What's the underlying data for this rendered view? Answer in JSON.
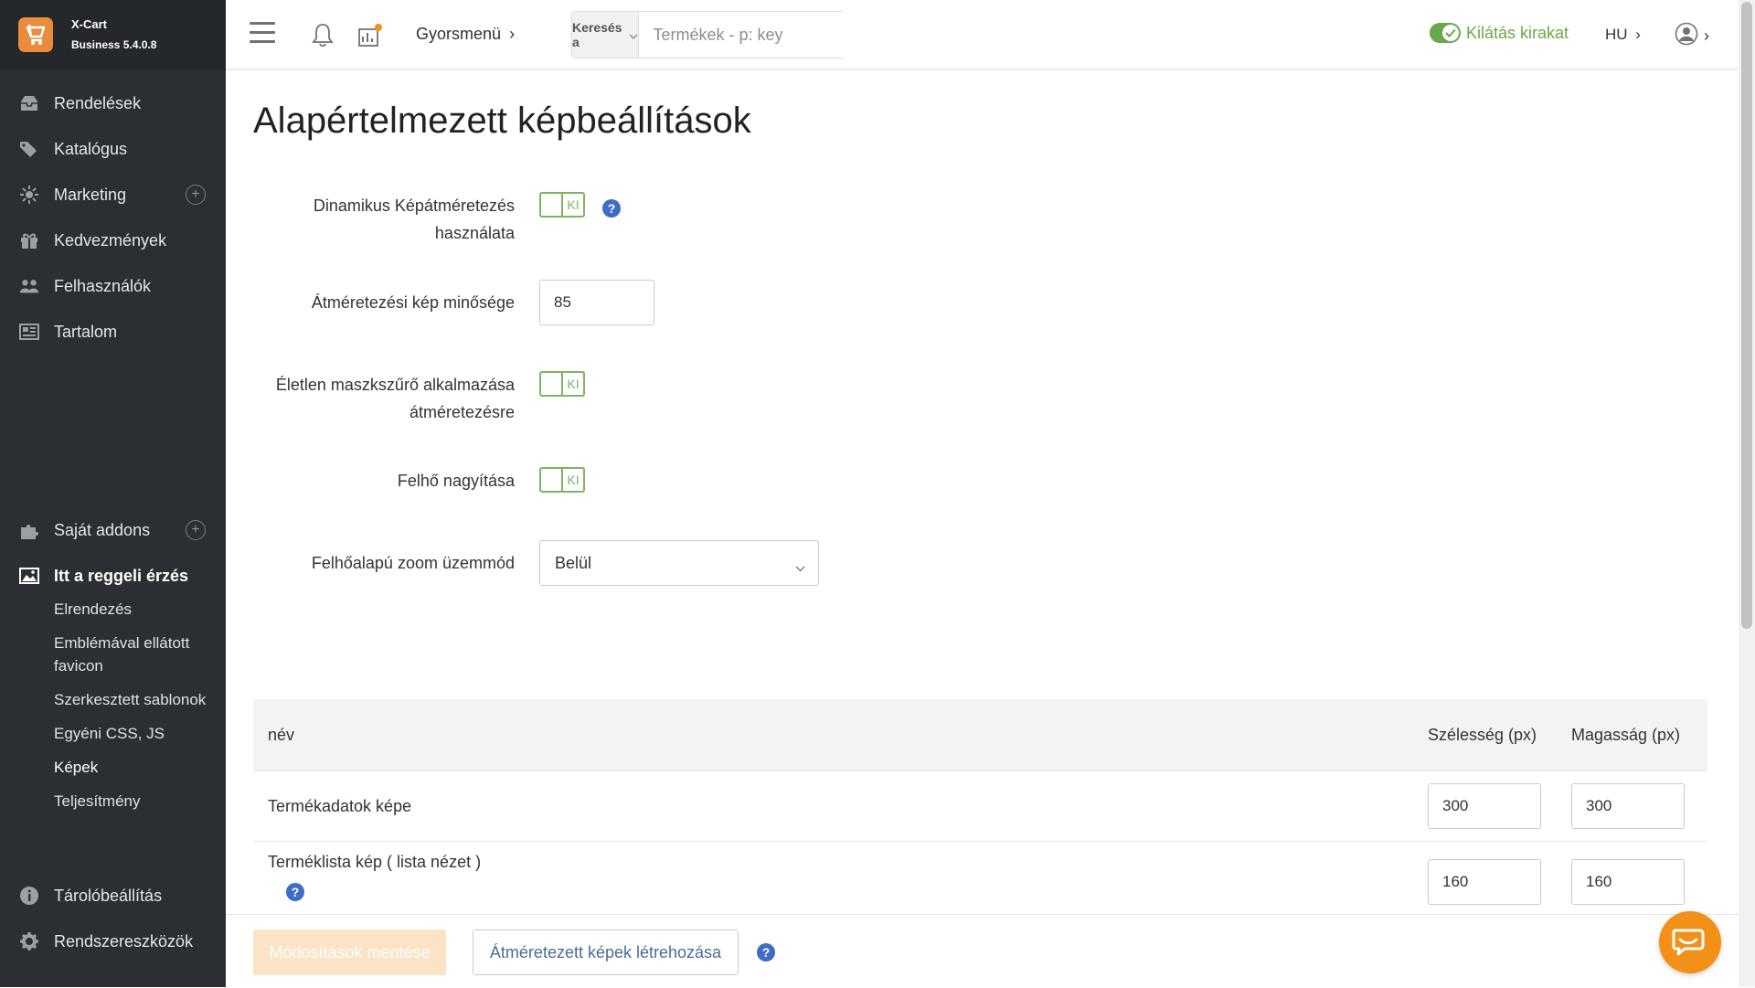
{
  "brand": {
    "name": "X-Cart",
    "version": "Business 5.4.0.8"
  },
  "sidebar": {
    "items": [
      {
        "label": "Rendelések",
        "icon": "orders-icon"
      },
      {
        "label": "Katalógus",
        "icon": "tags-icon"
      },
      {
        "label": "Marketing",
        "icon": "marketing-icon"
      },
      {
        "label": "Kedvezmények",
        "icon": "gift-icon"
      },
      {
        "label": "Felhasználók",
        "icon": "users-icon"
      },
      {
        "label": "Tartalom",
        "icon": "content-icon"
      }
    ],
    "addons_label": "Saját addons",
    "active_section": "Itt a reggeli érzés",
    "subitems": [
      "Elrendezés",
      "Emblémával ellátott favicon",
      "Szerkesztett sablonok",
      "Egyéni CSS, JS",
      "Képek",
      "Teljesítmény"
    ],
    "store_setup": "Tárolóbeállítás",
    "system_tools": "Rendszereszközök"
  },
  "topbar": {
    "quick_menu": "Gyorsmenü",
    "search_type": "Keresés a",
    "search_placeholder": "Termékek - p: key",
    "storefront_label": "Kilátás kirakat",
    "language": "HU"
  },
  "page": {
    "title": "Alapértelmezett képbeállítások",
    "fields": {
      "dynamic_resize": {
        "label_line1": "Dinamikus Képátméretezés",
        "label_line2": "használata",
        "state": "KI"
      },
      "quality": {
        "label": "Átméretezési kép minősége",
        "value": "85"
      },
      "unsharp": {
        "label_line1": "Életlen maszkszűrő alkalmazása",
        "label_line2": "átméretezésre",
        "state": "KI"
      },
      "cloud_zoom": {
        "label": "Felhő nagyítása",
        "state": "KI"
      },
      "cloud_zoom_mode": {
        "label": "Felhőalapú zoom üzemmód",
        "value": "Belül"
      }
    },
    "table": {
      "headers": {
        "name": "név",
        "width": "Szélesség (px)",
        "height": "Magasság (px)"
      },
      "rows": [
        {
          "name": "Termékadatok képe",
          "width": "300",
          "height": "300"
        },
        {
          "name": "Terméklista kép ( lista nézet )",
          "width": "160",
          "height": "160"
        }
      ]
    }
  },
  "actions": {
    "save": "Módosítások mentése",
    "generate": "Átméretezett képek létrehozása"
  },
  "colors": {
    "sidebar_bg": "#2b2f33",
    "accent_green": "#68a84a",
    "help_blue": "#3f6cc6",
    "chat_orange": "#f29018",
    "brand_orange": "#e98d3d"
  }
}
